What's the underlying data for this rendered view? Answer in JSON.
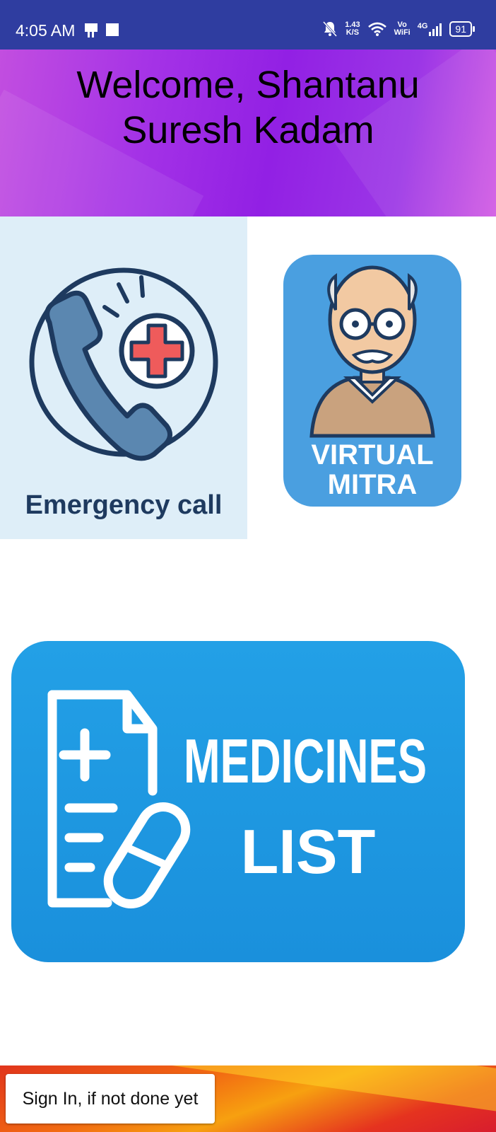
{
  "status_bar": {
    "time": "4:05 AM",
    "net_speed_value": "1.43",
    "net_speed_unit": "K/S",
    "vowifi_top": "Vo",
    "vowifi_bottom": "WiFi",
    "network": "4G",
    "battery": "91",
    "icons": [
      "phone-device-icon",
      "square-notification-icon",
      "muted-bell-icon",
      "wifi-icon",
      "signal-icon",
      "battery-icon"
    ]
  },
  "header": {
    "welcome_line1": "Welcome, Shantanu",
    "welcome_line2": "Suresh Kadam"
  },
  "tiles": {
    "emergency": {
      "label": "Emergency call",
      "icon": "phone-medical-icon"
    },
    "virtual_mitra": {
      "label_line1": "VIRTUAL",
      "label_line2": "MITRA",
      "icon": "elderly-man-icon"
    },
    "medicines": {
      "label_line1": "MEDICINES",
      "label_line2": "LIST",
      "icon": "prescription-pill-icon"
    }
  },
  "footer": {
    "signin_label": "Sign In, if not done yet"
  },
  "colors": {
    "status_bar": "#2f3da0",
    "header_purple": "#9220e4",
    "emergency_bg": "#deeef8",
    "navy": "#1e3a5f",
    "phone_blue": "#5b87b0",
    "cross_red": "#ef5b5b",
    "mitra_blue": "#4a9fe0",
    "medicines_blue": "#1f98e2",
    "footer_orange": "#f26a12"
  }
}
